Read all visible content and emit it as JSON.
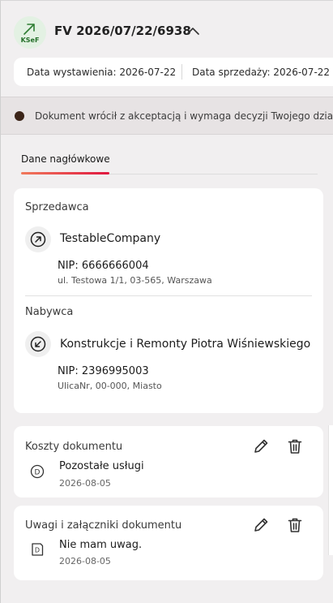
{
  "header": {
    "badge_label": "KSeF",
    "badge_icon": "arrow-up-right-icon",
    "document_number": "FV 2026/07/22/6938",
    "collapse_icon": "chevron-up-icon"
  },
  "dates": {
    "issue": "Data wystawienia: 2026-07-22",
    "sale": "Data sprzedaży: 2026-07-22"
  },
  "status": {
    "text": "Dokument wrócił z akceptacją i wymaga decyzji Twojego działu",
    "dot_color": "#3b2418"
  },
  "tabs": [
    {
      "label": "Dane nagłówkowe",
      "active": true
    }
  ],
  "seller": {
    "section_label": "Sprzedawca",
    "name": "TestableCompany",
    "nip": "NIP: 6666666004",
    "address": "ul. Testowa 1/1, 03-565, Warszawa",
    "icon": "arrow-up-right-icon"
  },
  "buyer": {
    "section_label": "Nabywca",
    "name": "Konstrukcje i Remonty Piotra Wiśniewskiego",
    "nip": "NIP: 2396995003",
    "address": "UlicaNr, 00-000, Miasto",
    "icon": "arrow-down-left-icon"
  },
  "costs": {
    "title": "Koszty dokumentu",
    "item_title": "Pozostałe usługi",
    "item_date": "2026-08-05",
    "item_icon": "letter-d-circle-icon",
    "edit_icon": "pencil-icon",
    "delete_icon": "trash-icon"
  },
  "notes": {
    "title": "Uwagi i załączniki dokumentu",
    "item_title": "Nie mam uwag.",
    "item_date": "2026-08-05",
    "item_icon": "letter-d-document-icon",
    "edit_icon": "pencil-icon",
    "delete_icon": "trash-icon"
  },
  "colors": {
    "accent_start": "#f07a5c",
    "accent_end": "#e0173f",
    "ksef_green": "#256f2a",
    "background": "#f1eff0"
  }
}
